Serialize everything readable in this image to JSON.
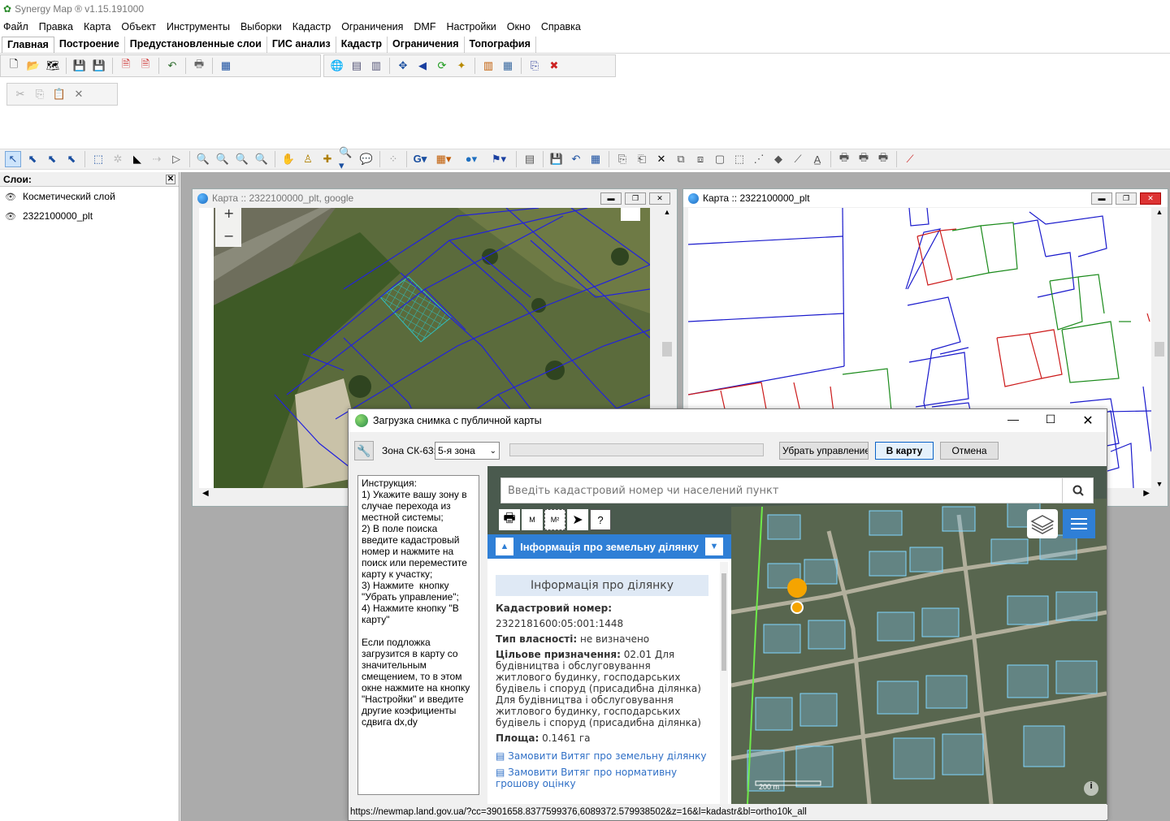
{
  "app": {
    "title": "Synergy Map ® v1.15.191000"
  },
  "menu": [
    "Файл",
    "Правка",
    "Карта",
    "Объект",
    "Инструменты",
    "Выборки",
    "Кадастр",
    "Ограничения",
    "DMF",
    "Настройки",
    "Окно",
    "Справка"
  ],
  "ribbon_tabs": [
    "Главная",
    "Построение",
    "Предустановленные слои",
    "ГИС анализ",
    "Кадастр",
    "Ограничения",
    "Топография"
  ],
  "layers": {
    "title": "Слои:",
    "items": [
      "Косметический слой",
      "2322100000_plt"
    ]
  },
  "map_windows": [
    {
      "title": "Карта :: 2322100000_plt, google"
    },
    {
      "title": "Карта :: 2322100000_plt"
    }
  ],
  "map_controls": {
    "zoom_in": "+",
    "zoom_out": "−"
  },
  "dialog": {
    "title": "Загрузка снимка с публичной карты",
    "zone_label": "Зона СК-63:",
    "zone_value": "5-я зона",
    "remove_control": "Убрать управление",
    "to_map": "В карту",
    "cancel": "Отмена",
    "instructions": "Инструкция:\n1) Укажите вашу зону в случае перехода из местной системы;\n2) В поле поиска введите кадастровый номер и нажмите на поиск или переместите карту к участку;\n3) Нажмите  кнопку \"Убрать управление\";\n4) Нажмите кнопку \"В карту\"\n\nЕсли подложка загрузится в карту со значительным смещением, то в этом окне нажмите на кнопку \"Настройки\" и введите другие коэфициенты сдвига dx,dy",
    "status_url": "https://newmap.land.gov.ua/?cc=3901658.8377599376,6089372.579938502&z=16&l=kadastr&bl=ortho10k_all"
  },
  "web": {
    "search_placeholder": "Введіть кадастровий номер чи населений пункт",
    "panel_header": "Інформація про земельну ділянку",
    "panel_sub": "Інформація про ділянку",
    "cad_label": "Кадастровий номер:",
    "cad_value": "2322181600:05:001:1448",
    "ownership_label": "Тип власності:",
    "ownership_value": " не визначено",
    "purpose_label": "Цільове призначення:",
    "purpose_value": " 02.01 Для будівництва і обслуговування житлового будинку, господарських будівель і споруд (присадибна ділянка) Для будівництва і обслуговування житлового будинку, господарських будівель і споруд (присадибна ділянка)",
    "area_label": "Площа:",
    "area_value": " 0.1461 га",
    "link1": "Замовити Витяг про земельну ділянку",
    "link2": "Замовити Витяг про нормативну грошову оцінку",
    "scale": "200 m",
    "tool_m": "M",
    "tool_m2": "M²"
  },
  "colors": {
    "accent": "#2f7fd6",
    "parcel_blue": "#1a1acc",
    "parcel_red": "#cc1a1a",
    "parcel_green": "#1a8a1a"
  }
}
